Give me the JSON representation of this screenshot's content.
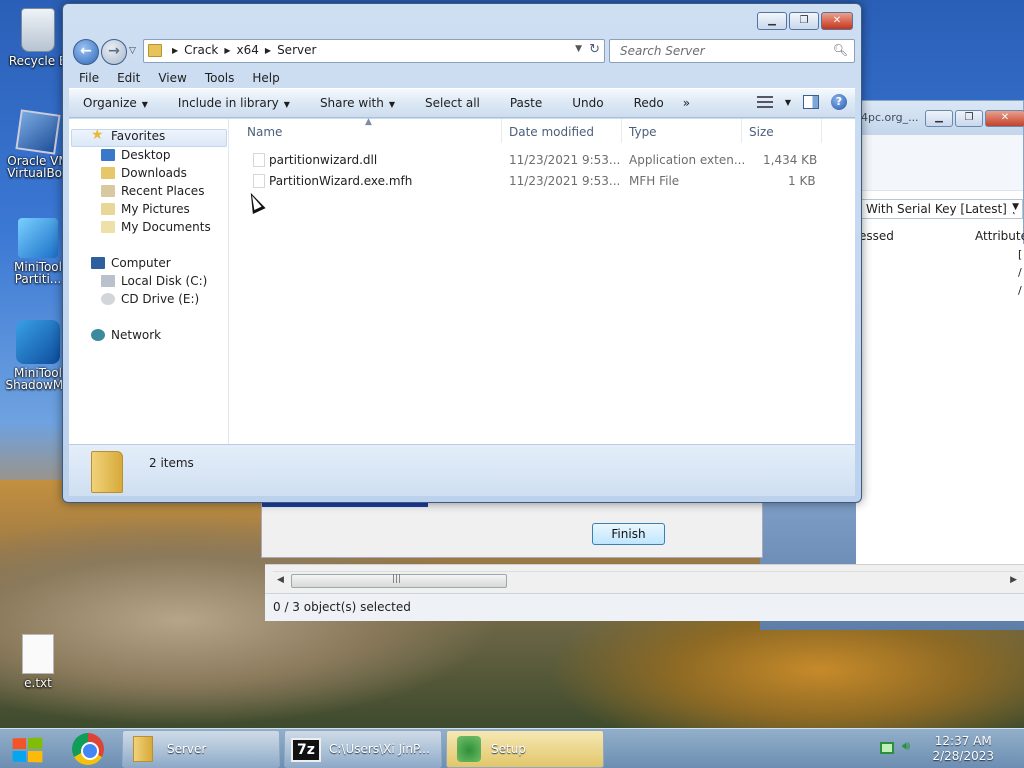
{
  "desktop": {
    "icons": [
      {
        "label": "Recycle Bin",
        "short": "Recycle B"
      },
      {
        "label": "Oracle VM VirtualBox",
        "short": "Oracle VM\nVirtualBox"
      },
      {
        "label": "MiniTool Partition",
        "short": "MiniTool\nPartiti..."
      },
      {
        "label": "MiniTool ShadowMaker",
        "short": "MiniTool\nShadowMa"
      },
      {
        "label": "e.txt",
        "short": "e.txt"
      }
    ],
    "icon_lines": {
      "recycle": "Recycle B",
      "vbox_1": "Oracle VM",
      "vbox_2": "VirtualBox",
      "mtp_1": "MiniTool",
      "mtp_2": "Partiti...",
      "msm_1": "MiniTool",
      "msm_2": "ShadowMa",
      "txt": "e.txt"
    }
  },
  "bg_window": {
    "title_fragment": "4pc.org_...",
    "dropdown_text": "With Serial Key [Latest] \\",
    "headers": [
      "essed",
      "Attribute"
    ],
    "list_fragments": [
      "[",
      "/",
      "/"
    ],
    "status_text": "0 / 3 object(s) selected"
  },
  "setup_dialog": {
    "finish_label": "Finish"
  },
  "explorer": {
    "breadcrumb": [
      "Crack",
      "x64",
      "Server"
    ],
    "search_placeholder": "Search Server",
    "menu": [
      "File",
      "Edit",
      "View",
      "Tools",
      "Help"
    ],
    "commands": {
      "organize": "Organize",
      "include": "Include in library",
      "share": "Share with",
      "select_all": "Select all",
      "paste": "Paste",
      "undo": "Undo",
      "redo": "Redo",
      "more": "»"
    },
    "nav": {
      "favorites": "Favorites",
      "desktop": "Desktop",
      "downloads": "Downloads",
      "recent": "Recent Places",
      "pictures": "My Pictures",
      "documents": "My Documents",
      "computer": "Computer",
      "local_disk": "Local Disk (C:)",
      "cd_drive": "CD Drive (E:)",
      "network": "Network"
    },
    "columns": {
      "name": "Name",
      "date": "Date modified",
      "type": "Type",
      "size": "Size"
    },
    "files": [
      {
        "name": "partitionwizard.dll",
        "date": "11/23/2021 9:53...",
        "type": "Application exten...",
        "size": "1,434 KB"
      },
      {
        "name": "PartitionWizard.exe.mfh",
        "date": "11/23/2021 9:53...",
        "type": "MFH File",
        "size": "1 KB"
      }
    ],
    "item_count": "2 items"
  },
  "taskbar": {
    "server_label": "Server",
    "sevenzip_label": "C:\\Users\\Xi JinP...",
    "setup_label": "Setup",
    "time": "12:37 AM",
    "date": "2/28/2023"
  }
}
